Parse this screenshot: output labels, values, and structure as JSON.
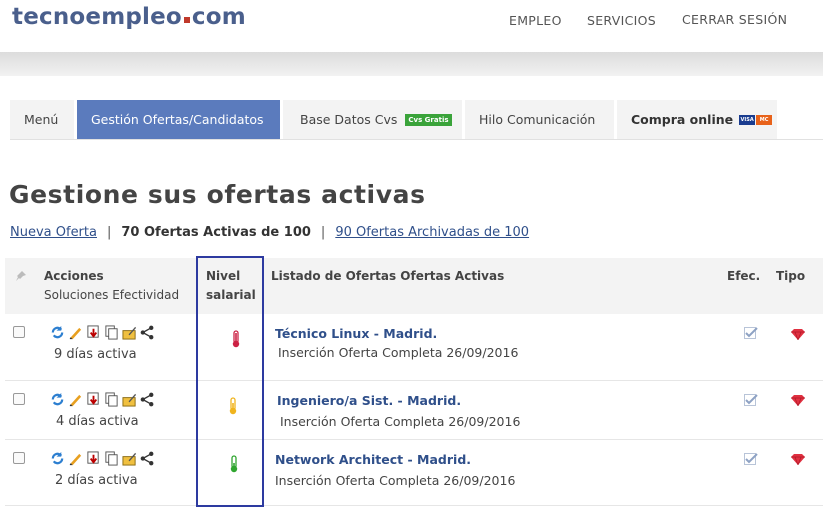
{
  "header": {
    "logo_main": "tecnoempleo",
    "logo_tld": "com",
    "nav": [
      "EMPLEO",
      "SERVICIOS",
      "CERRAR SESIÓN"
    ]
  },
  "tabs": [
    {
      "label": "Menú",
      "active": false
    },
    {
      "label": "Gestión Ofertas/Candidatos",
      "active": true
    },
    {
      "label": "Base Datos Cvs",
      "badge": "Cvs Gratis",
      "active": false
    },
    {
      "label": "Hilo Comunicación",
      "active": false
    },
    {
      "label": "Compra online",
      "cards": [
        "VISA",
        "MC"
      ],
      "active": false
    }
  ],
  "page_title": "Gestione sus ofertas activas",
  "summary": {
    "new_offer": "Nueva Oferta",
    "sep": "|",
    "active_count": "70 Ofertas Activas de 100",
    "archived": "90 Ofertas Archivadas de 100"
  },
  "table": {
    "headers": {
      "actions": "Acciones",
      "actions_sub": "Soluciones Efectividad",
      "salary_1": "Nivel",
      "salary_2": "salarial",
      "listing": "Listado de Ofertas Ofertas Activas",
      "efec": "Efec.",
      "tipo": "Tipo"
    },
    "rows": [
      {
        "title": "Técnico Linux",
        "location": " - Madrid.",
        "insertion": "Inserción Oferta Completa 26/09/2016",
        "days": "9 días activa",
        "salary_level": "high",
        "salary_color": "#cc2244"
      },
      {
        "title": "Ingeniero/a Sist.",
        "location": " - Madrid.",
        "insertion": "Inserción Oferta Completa 26/09/2016",
        "days": "4 días activa",
        "salary_level": "medium",
        "salary_color": "#f0b41e"
      },
      {
        "title": "Network Architect",
        "location": " - Madrid.",
        "insertion": "Inserción Oferta Completa 26/09/2016",
        "days": "2 días activa",
        "salary_level": "low",
        "salary_color": "#2fa52f"
      }
    ]
  },
  "icons": {
    "row_actions": [
      "refresh-icon",
      "edit-pencil-icon",
      "download-icon",
      "copy-icon",
      "folder-edit-icon",
      "share-icon"
    ],
    "efec": "checkmark-icon",
    "tipo": "ruby-gem-icon",
    "salary": "thermometer-icon"
  },
  "colors": {
    "brand": "#4a5f8c",
    "accent_tab": "#5b7bbd",
    "link": "#2f4f8a",
    "highlight_box": "#2d3aa0",
    "gem": "#e03040"
  }
}
